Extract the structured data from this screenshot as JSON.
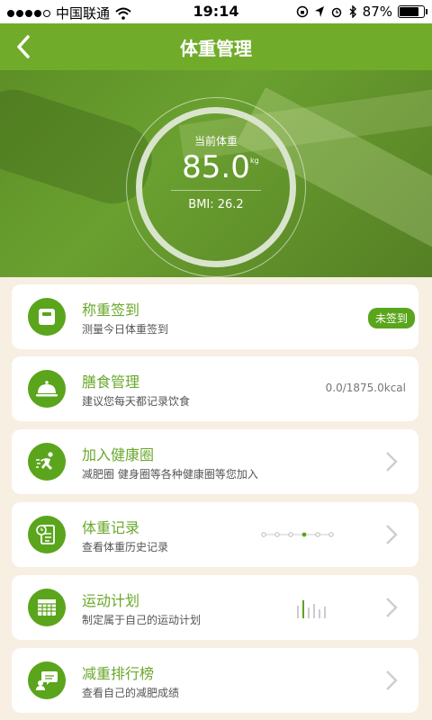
{
  "status": {
    "carrier": "中国联通",
    "time": "19:14",
    "battery": "87%",
    "battery_level": 0.87
  },
  "nav": {
    "title": "体重管理"
  },
  "hero": {
    "label": "当前体重",
    "value": "85.0",
    "unit": "kg",
    "bmi": "BMI: 26.2"
  },
  "cards": [
    {
      "title": "称重签到",
      "subtitle": "测量今日体重签到",
      "badge": "未签到",
      "icon": "scale-icon"
    },
    {
      "title": "膳食管理",
      "subtitle": "建议您每天都记录饮食",
      "value": "0.0/1875.0kcal",
      "icon": "cloche-icon"
    },
    {
      "title": "加入健康圈",
      "subtitle": "减肥圈 健身圈等各种健康圈等您加入",
      "icon": "runner-icon"
    },
    {
      "title": "体重记录",
      "subtitle": "查看体重历史记录",
      "icon": "clipboard-clock-icon"
    },
    {
      "title": "运动计划",
      "subtitle": "制定属于自己的运动计划",
      "icon": "calendar-icon"
    },
    {
      "title": "减重排行榜",
      "subtitle": "查看自己的减肥成绩",
      "icon": "chat-bubble-person-icon"
    }
  ],
  "colors": {
    "brand_green": "#70ac2a",
    "icon_green": "#5aa51c",
    "background": "#f6efe2"
  }
}
